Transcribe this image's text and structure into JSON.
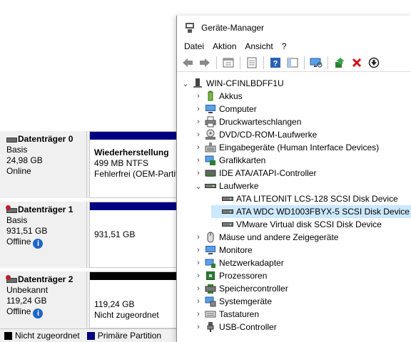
{
  "disk_management": {
    "disks": [
      {
        "name": "Datenträger 0",
        "type": "Basis",
        "size": "24,98 GB",
        "status": "Online",
        "partition": {
          "name": "Wiederherstellung",
          "size": "499 MB NTFS",
          "status": "Fehlerfrei (OEM-Partit"
        }
      },
      {
        "name": "Datenträger 1",
        "type": "Basis",
        "size": "931,51 GB",
        "status": "Offline",
        "partition": {
          "size": "931,51 GB"
        }
      },
      {
        "name": "Datenträger 2",
        "type": "Unbekannt",
        "size": "119,24 GB",
        "status": "Offline",
        "partition": {
          "size": "119,24 GB",
          "status": "Nicht zugeordnet"
        }
      }
    ],
    "legend": {
      "unallocated": "Nicht zugeordnet",
      "primary": "Primäre Partition"
    },
    "colors": {
      "primary": "#000080",
      "unallocated": "#000000"
    }
  },
  "device_manager": {
    "title": "Geräte-Manager",
    "menu": [
      "Datei",
      "Aktion",
      "Ansicht",
      "?"
    ],
    "toolbar_icons": [
      "back-arrow-icon",
      "forward-arrow-icon",
      "properties-icon",
      "list-icon",
      "help-icon",
      "panel-icon",
      "monitor-scan-icon",
      "update-driver-icon",
      "uninstall-icon",
      "disable-icon"
    ],
    "tree": {
      "root": "WIN-CFINLBDFF1U",
      "categories": [
        "Akkus",
        "Computer",
        "Druckwarteschlangen",
        "DVD/CD-ROM-Laufwerke",
        "Eingabegeräte (Human Interface Devices)",
        "Grafikkarten",
        "IDE ATA/ATAPI-Controller",
        "Laufwerke",
        "Mäuse und andere Zeigegeräte",
        "Monitore",
        "Netzwerkadapter",
        "Prozessoren",
        "Speichercontroller",
        "Systemgeräte",
        "Tastaturen",
        "USB-Controller"
      ],
      "drives": [
        "ATA LITEONIT LCS-128 SCSI Disk Device",
        "ATA WDC WD1003FBYX-5 SCSI Disk Device",
        "VMware Virtual disk SCSI Disk Device"
      ],
      "selected": "ATA WDC WD1003FBYX-5 SCSI Disk Device"
    }
  }
}
